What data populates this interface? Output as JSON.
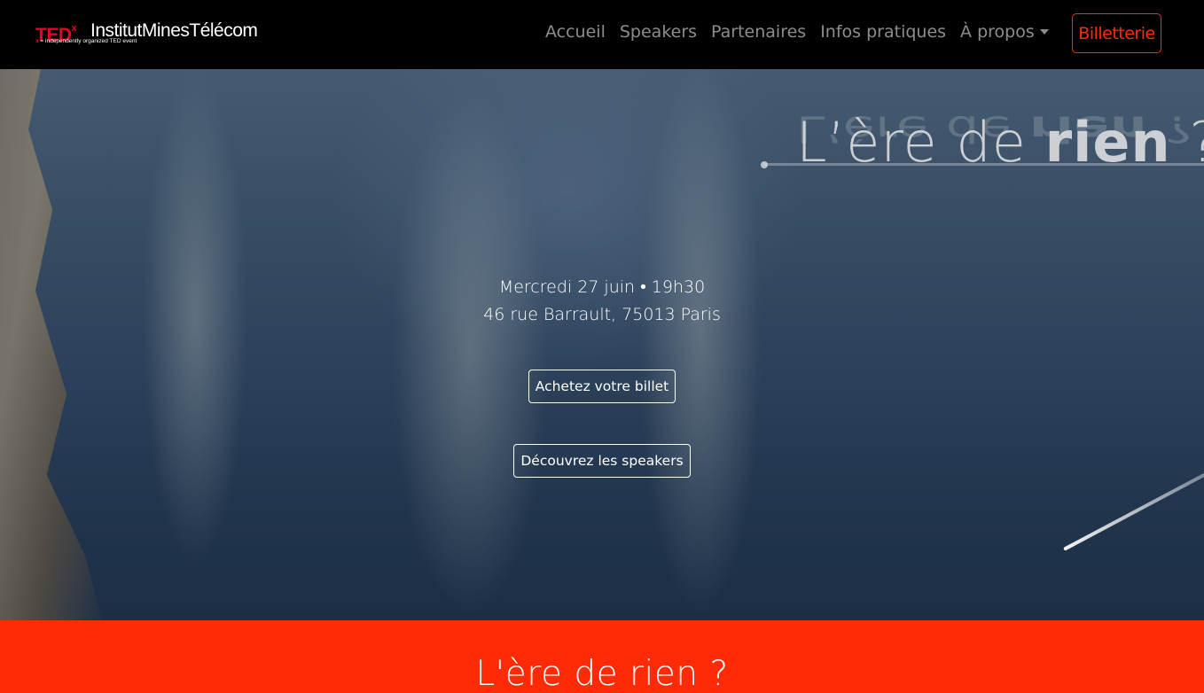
{
  "navbar": {
    "logo": {
      "tedx": "TED",
      "tedx_x": "x",
      "org": "InstitutMinesTélécom",
      "tagline_x": "x",
      "tagline": " = independently organized TED event"
    },
    "links": [
      {
        "label": "Accueil"
      },
      {
        "label": "Speakers"
      },
      {
        "label": "Partenaires"
      },
      {
        "label": "Infos pratiques"
      },
      {
        "label": "À propos"
      }
    ],
    "ticket_button": "Billetterie"
  },
  "hero": {
    "title_light": "L’ère de ",
    "title_bold": "rien",
    "title_end": " ?",
    "date": "Mercredi 27 juin • 19h30",
    "address": "46 rue Barrault, 75013 Paris",
    "buy_button": "Achetez votre billet",
    "speakers_button": "Découvrez les speakers"
  },
  "section": {
    "title": "L'ère de rien ?"
  },
  "colors": {
    "accent": "#ff2b06",
    "tedx_red": "#eb0028",
    "navbar_bg": "#000000"
  }
}
